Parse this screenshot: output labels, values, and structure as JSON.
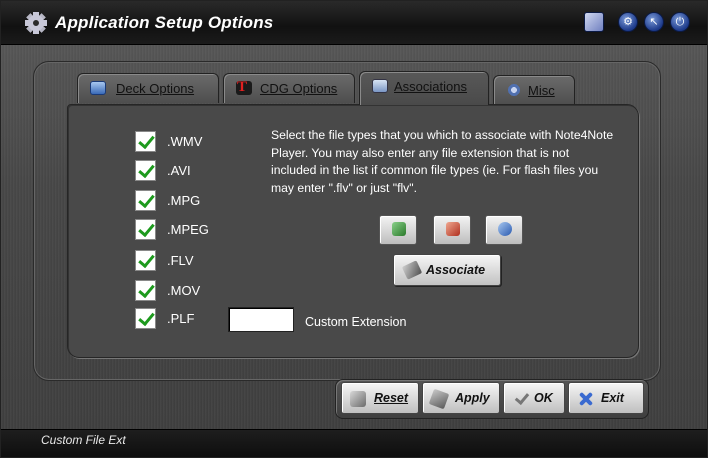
{
  "window": {
    "title": "Application Setup Options"
  },
  "titlebar_buttons": [
    {
      "icon": "edit-icon"
    },
    {
      "icon": "gear-icon"
    },
    {
      "icon": "arrow-icon"
    },
    {
      "icon": "power-icon"
    }
  ],
  "tabs": {
    "deck": "Deck Options",
    "cdg": "CDG Options",
    "associations": "Associations",
    "misc": "Misc",
    "active": "Associations"
  },
  "file_types": [
    {
      "label": ".WMV",
      "checked": true
    },
    {
      "label": ".AVI",
      "checked": true
    },
    {
      "label": ".MPG",
      "checked": true
    },
    {
      "label": ".MPEG",
      "checked": true
    },
    {
      "label": ".FLV",
      "checked": true
    },
    {
      "label": ".MOV",
      "checked": true
    },
    {
      "label": ".PLF",
      "checked": true
    }
  ],
  "description": "Select the file types that you which to associate with Note4Note Player. You may also enter any file extension that is not included in the list if common file types (ie. For flash files you may enter \".flv\" or just \"flv\".",
  "custom_extension": {
    "value": "",
    "label": "Custom Extension"
  },
  "associate_button": "Associate",
  "actions": {
    "reset": "Reset",
    "apply": "Apply",
    "ok": "OK",
    "exit": "Exit"
  },
  "status_text": "Custom File Ext"
}
